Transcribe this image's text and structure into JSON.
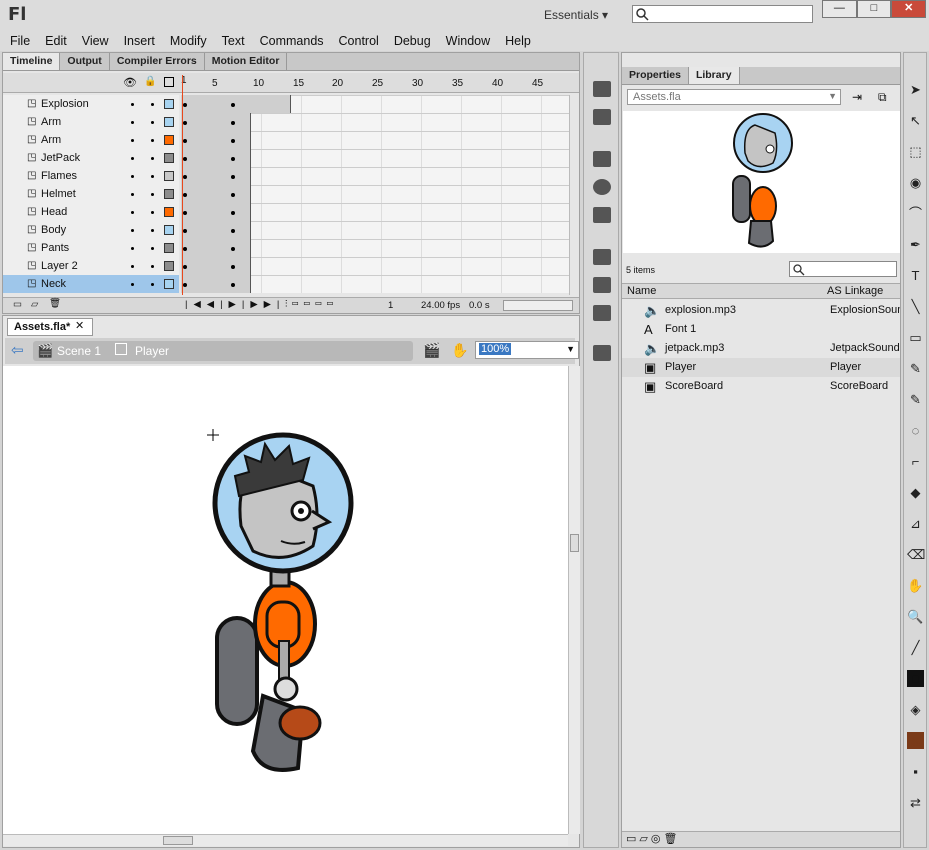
{
  "app": {
    "logo": "Fl",
    "workspace": "Essentials",
    "workspace_arrow": "▾"
  },
  "window_buttons": {
    "minimize": "—",
    "maximize": "□",
    "close": "✕"
  },
  "menu": [
    "File",
    "Edit",
    "View",
    "Insert",
    "Modify",
    "Text",
    "Commands",
    "Control",
    "Debug",
    "Window",
    "Help"
  ],
  "timeline": {
    "tabs": [
      "Timeline",
      "Output",
      "Compiler Errors",
      "Motion Editor"
    ],
    "ruler": [
      "1",
      "5",
      "10",
      "15",
      "20",
      "25",
      "30",
      "35",
      "40",
      "45"
    ],
    "layers": [
      {
        "name": "Explosion",
        "color": "#a7d3f0"
      },
      {
        "name": "Arm",
        "color": "#a7d3f0"
      },
      {
        "name": "Arm",
        "color": "#ff6a00"
      },
      {
        "name": "JetPack",
        "color": "#8c8c8c"
      },
      {
        "name": "Flames",
        "color": "#c8c8c8"
      },
      {
        "name": "Helmet",
        "color": "#8c8c8c"
      },
      {
        "name": "Head",
        "color": "#ff6a00"
      },
      {
        "name": "Body",
        "color": "#a7d3f0"
      },
      {
        "name": "Pants",
        "color": "#8c8c8c"
      },
      {
        "name": "Layer 2",
        "color": "#8c8c8c"
      },
      {
        "name": "Neck",
        "color": "#a7d3f0"
      }
    ],
    "footer": {
      "frame": "1",
      "fps": "24.00 fps",
      "time": "0.0 s"
    }
  },
  "document": {
    "tab": "Assets.fla*",
    "tab_close": "✕",
    "scene": "Scene 1",
    "symbol": "Player",
    "zoom": "100%"
  },
  "library": {
    "tabs": [
      "Properties",
      "Library"
    ],
    "file": "Assets.fla",
    "count": "5 items",
    "col_name": "Name",
    "col_link": "AS Linkage",
    "items": [
      {
        "icon": "🔈",
        "name": "explosion.mp3",
        "link": "ExplosionSound"
      },
      {
        "icon": "A",
        "name": "Font 1",
        "link": ""
      },
      {
        "icon": "🔈",
        "name": "jetpack.mp3",
        "link": "JetpackSound"
      },
      {
        "icon": "▣",
        "name": "Player",
        "link": "Player"
      },
      {
        "icon": "▣",
        "name": "ScoreBoard",
        "link": "ScoreBoard"
      }
    ]
  },
  "tools": [
    "➤",
    "↖",
    "⬚",
    "◉",
    "⌒",
    "✒",
    "T",
    "╲",
    "▭",
    "✎",
    "✎",
    "◌",
    "⌐",
    "◆",
    "⊿",
    "⌫",
    "✋",
    "🔍",
    "╱",
    "■",
    "◈",
    "▩",
    "▪",
    "⇄"
  ]
}
